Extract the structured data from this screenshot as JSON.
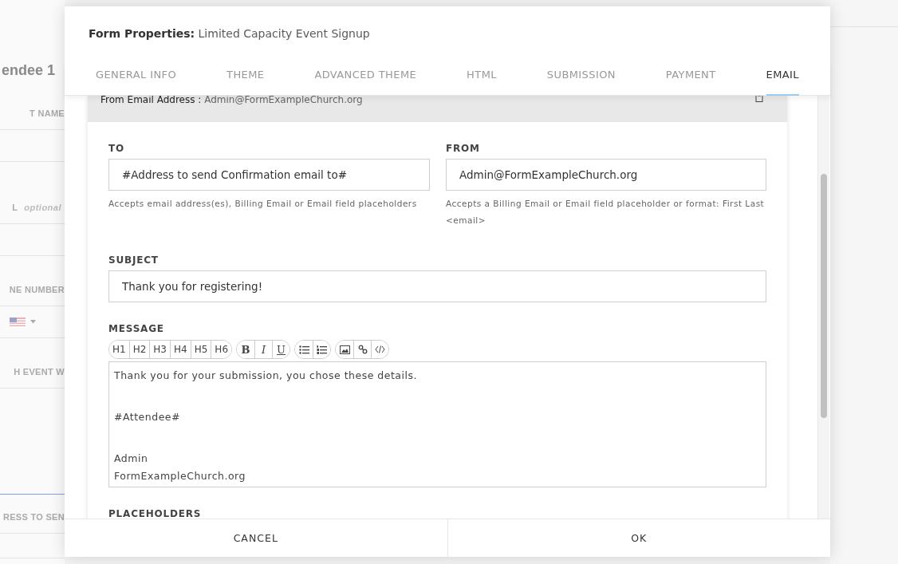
{
  "background_form": {
    "heading": "endee 1",
    "fields": [
      {
        "kind": "text",
        "label": "T NAME",
        "focused": false
      },
      {
        "kind": "text",
        "label": "L",
        "optional": "optional",
        "focused": false
      },
      {
        "kind": "phone",
        "label": "NE NUMBER",
        "focused": false
      },
      {
        "kind": "area",
        "label": "H EVENT W",
        "focused": true
      },
      {
        "kind": "text",
        "label": "RESS TO SEN",
        "focused": false
      }
    ]
  },
  "dialog": {
    "title_prefix": "Form Properties:",
    "title": "Limited Capacity Event Signup",
    "tabs": [
      {
        "label": "GENERAL INFO",
        "selected": false
      },
      {
        "label": "THEME",
        "selected": false
      },
      {
        "label": "ADVANCED THEME",
        "selected": false
      },
      {
        "label": "HTML",
        "selected": false
      },
      {
        "label": "SUBMISSION",
        "selected": false
      },
      {
        "label": "PAYMENT",
        "selected": false
      },
      {
        "label": "EMAIL",
        "selected": true
      }
    ],
    "email_header": {
      "label": "From Email Address :",
      "value": "Admin@FormExampleChurch.org"
    },
    "to": {
      "label": "TO",
      "value": "#Address to send Confirmation email to#",
      "hint": "Accepts email address(es), Billing Email or Email field placeholders"
    },
    "from": {
      "label": "FROM",
      "value": "Admin@FormExampleChurch.org",
      "hint": "Accepts a Billing Email or Email field placeholder or format: First Last <email>"
    },
    "subject": {
      "label": "SUBJECT",
      "value": "Thank you for registering!"
    },
    "message": {
      "label": "MESSAGE",
      "headings": [
        "H1",
        "H2",
        "H3",
        "H4",
        "H5",
        "H6"
      ],
      "styles": [
        "B",
        "I",
        "U"
      ],
      "paragraphs": [
        [
          "Thank you for your submission, you chose these details."
        ],
        [
          "#Attendee#"
        ],
        [
          "Admin",
          "FormExampleChurch.org"
        ]
      ]
    },
    "placeholders_label": "PLACEHOLDERS",
    "buttons": [
      "CANCEL",
      "OK"
    ]
  }
}
